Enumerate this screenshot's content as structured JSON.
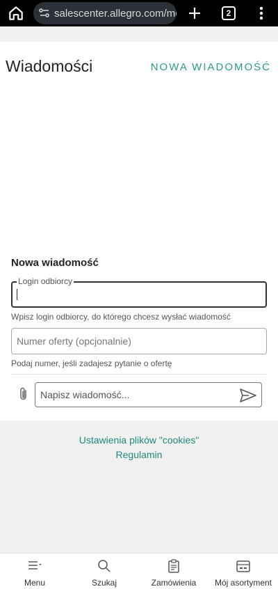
{
  "browser": {
    "url": "salescenter.allegro.com/mess",
    "tab_count": "2"
  },
  "header": {
    "title": "Wiadomości",
    "new_message_link": "NOWA WIADOMOŚĆ"
  },
  "form": {
    "heading": "Nowa wiadomość",
    "login_label": "Login odbiorcy",
    "login_value": "",
    "login_hint": "Wpisz login odbiorcy, do którego chcesz wysłać wiadomość",
    "offer_placeholder": "Numer oferty (opcjonalnie)",
    "offer_hint": "Podaj numer, jeśli zadajesz pytanie o ofertę",
    "message_placeholder": "Napisz wiadomość..."
  },
  "footer": {
    "cookies_link": "Ustawienia plików \"cookies\"",
    "terms_link": "Regulamin"
  },
  "bottom_nav": {
    "menu": "Menu",
    "search": "Szukaj",
    "orders": "Zamówienia",
    "assortment": "Mój asortyment"
  },
  "colors": {
    "accent": "#2d9b8a",
    "link": "#1d8a7a"
  }
}
